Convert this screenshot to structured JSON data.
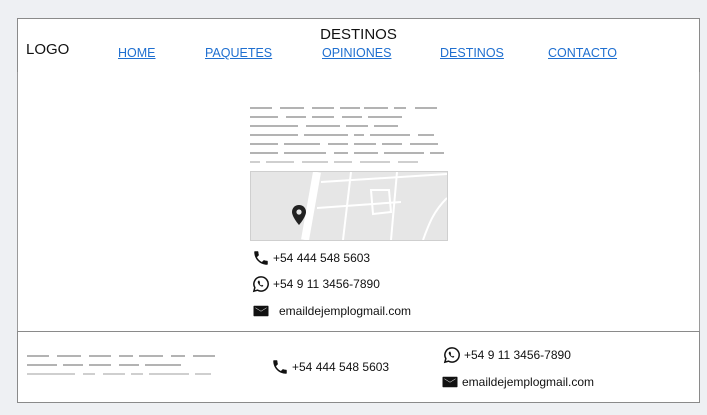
{
  "header": {
    "logo": "LOGO",
    "title": "DESTINOS",
    "nav": [
      "HOME",
      "PAQUETES",
      "OPINIONES",
      "DESTINOS",
      "CONTACTO"
    ]
  },
  "main": {
    "map_icon": "map-pin-icon",
    "contacts": {
      "phone": "+54 444 548 5603",
      "whatsapp": "+54 9 11 3456-7890",
      "email": "emaildejemplogmail.com"
    }
  },
  "footer": {
    "phone": "+54 444 548 5603",
    "whatsapp": "+54 9 11 3456-7890",
    "email": "emaildejemplogmail.com"
  },
  "icons": [
    "phone-icon",
    "whatsapp-icon",
    "mail-icon"
  ],
  "colors": {
    "link": "#1f6fd0",
    "placeholder": "#b3b3b3",
    "border": "#8a8a8a"
  }
}
